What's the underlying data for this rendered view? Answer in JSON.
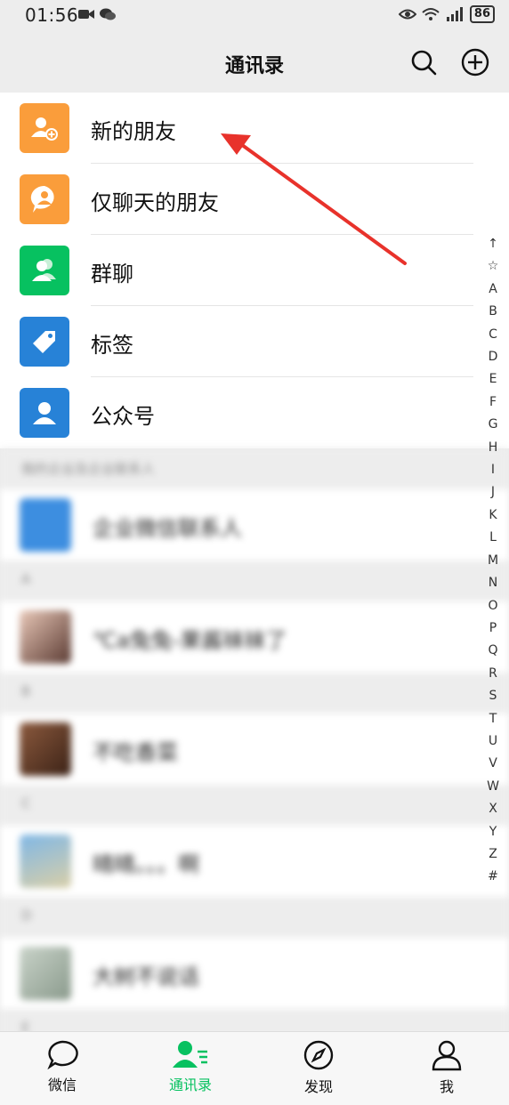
{
  "status_bar": {
    "time": "01:56",
    "battery": "86"
  },
  "header": {
    "title": "通讯录"
  },
  "menu_items": [
    {
      "label": "新的朋友",
      "icon": "add-friend-icon",
      "color": "#fa9d3b"
    },
    {
      "label": "仅聊天的朋友",
      "icon": "chat-only-icon",
      "color": "#fa9d3b"
    },
    {
      "label": "群聊",
      "icon": "group-icon",
      "color": "#07c160"
    },
    {
      "label": "标签",
      "icon": "tag-icon",
      "color": "#2782d7"
    },
    {
      "label": "公众号",
      "icon": "official-account-icon",
      "color": "#2782d7"
    }
  ],
  "sections": [
    {
      "header": "我的企业及企业联系人",
      "contacts": [
        {
          "name": "企业微信联系人"
        }
      ]
    },
    {
      "header": "A",
      "contacts": [
        {
          "name": "℃a兔兔-果酱袜袜了"
        }
      ]
    },
    {
      "header": "B",
      "contacts": [
        {
          "name": "不吃香菜"
        }
      ]
    },
    {
      "header": "C",
      "contacts": [
        {
          "name": "晴晴。。。啊"
        }
      ]
    },
    {
      "header": "D",
      "contacts": [
        {
          "name": "大树不说话"
        }
      ]
    },
    {
      "header": "E",
      "contacts": []
    }
  ],
  "index_letters": [
    "↑",
    "☆",
    "A",
    "B",
    "C",
    "D",
    "E",
    "F",
    "G",
    "H",
    "I",
    "J",
    "K",
    "L",
    "M",
    "N",
    "O",
    "P",
    "Q",
    "R",
    "S",
    "T",
    "U",
    "V",
    "W",
    "X",
    "Y",
    "Z",
    "#"
  ],
  "tabs": [
    {
      "label": "微信",
      "icon": "chat-bubble-icon",
      "active": false
    },
    {
      "label": "通讯录",
      "icon": "contacts-icon",
      "active": true
    },
    {
      "label": "发现",
      "icon": "compass-icon",
      "active": false
    },
    {
      "label": "我",
      "icon": "person-icon",
      "active": false
    }
  ],
  "colors": {
    "accent": "#07c160",
    "annotation_arrow": "#e8322b"
  }
}
